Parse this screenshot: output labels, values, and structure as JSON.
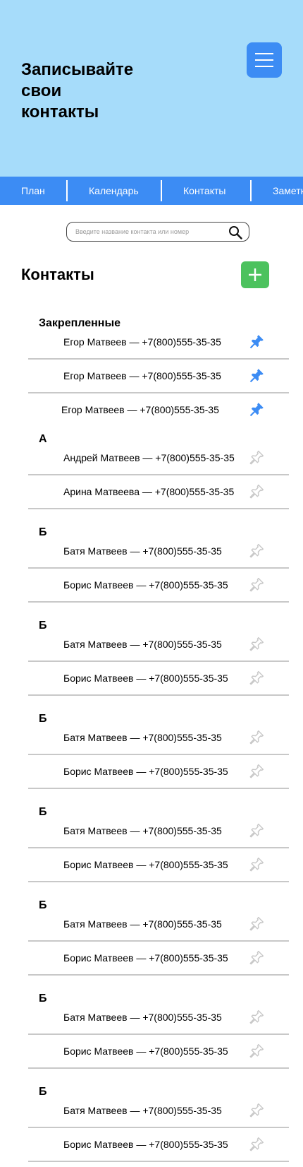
{
  "hero": {
    "title": "Записывайте\nсвои\nконтакты",
    "background_color": "#a6dcfa",
    "menu_icon": "hamburger-menu-icon"
  },
  "nav": {
    "background_color": "#3c8cf4",
    "items": [
      {
        "label": "План"
      },
      {
        "label": "Календарь"
      },
      {
        "label": "Контакты"
      },
      {
        "label": "Заметки"
      }
    ]
  },
  "search": {
    "value": "",
    "placeholder": "Введите название контакта или номер",
    "icon": "search-icon"
  },
  "page": {
    "title": "Контакты",
    "add_icon": "plus-icon",
    "add_color": "#4cc25e"
  },
  "pin_colors": {
    "pinned": "#3c8cf4",
    "unpinned": "#c8c8c8"
  },
  "sections": [
    {
      "title": "Закрепленные",
      "contacts": [
        {
          "text": "Егор Матвеев — +7(800)555-35-35",
          "pinned": true
        },
        {
          "text": "Егор Матвеев — +7(800)555-35-35",
          "pinned": true
        },
        {
          "text": "Егор Матвеев — +7(800)555-35-35",
          "pinned": true
        }
      ]
    },
    {
      "title": "А",
      "contacts": [
        {
          "text": "Андрей Матвеев — +7(800)555-35-35",
          "pinned": false
        },
        {
          "text": "Арина Матвеева — +7(800)555-35-35",
          "pinned": false
        }
      ]
    },
    {
      "title": "Б",
      "contacts": [
        {
          "text": "Батя Матвеев — +7(800)555-35-35",
          "pinned": false
        },
        {
          "text": "Борис Матвеев — +7(800)555-35-35",
          "pinned": false
        }
      ]
    },
    {
      "title": "Б",
      "contacts": [
        {
          "text": "Батя Матвеев — +7(800)555-35-35",
          "pinned": false
        },
        {
          "text": "Борис Матвеев — +7(800)555-35-35",
          "pinned": false
        }
      ]
    },
    {
      "title": "Б",
      "contacts": [
        {
          "text": "Батя Матвеев — +7(800)555-35-35",
          "pinned": false
        },
        {
          "text": "Борис Матвеев — +7(800)555-35-35",
          "pinned": false
        }
      ]
    },
    {
      "title": "Б",
      "contacts": [
        {
          "text": "Батя Матвеев — +7(800)555-35-35",
          "pinned": false
        },
        {
          "text": "Борис Матвеев — +7(800)555-35-35",
          "pinned": false
        }
      ]
    },
    {
      "title": "Б",
      "contacts": [
        {
          "text": "Батя Матвеев — +7(800)555-35-35",
          "pinned": false
        },
        {
          "text": "Борис Матвеев — +7(800)555-35-35",
          "pinned": false
        }
      ]
    },
    {
      "title": "Б",
      "contacts": [
        {
          "text": "Батя Матвеев — +7(800)555-35-35",
          "pinned": false
        },
        {
          "text": "Борис Матвеев — +7(800)555-35-35",
          "pinned": false
        }
      ]
    },
    {
      "title": "Б",
      "contacts": [
        {
          "text": "Батя Матвеев — +7(800)555-35-35",
          "pinned": false
        },
        {
          "text": "Борис Матвеев — +7(800)555-35-35",
          "pinned": false
        }
      ]
    }
  ]
}
